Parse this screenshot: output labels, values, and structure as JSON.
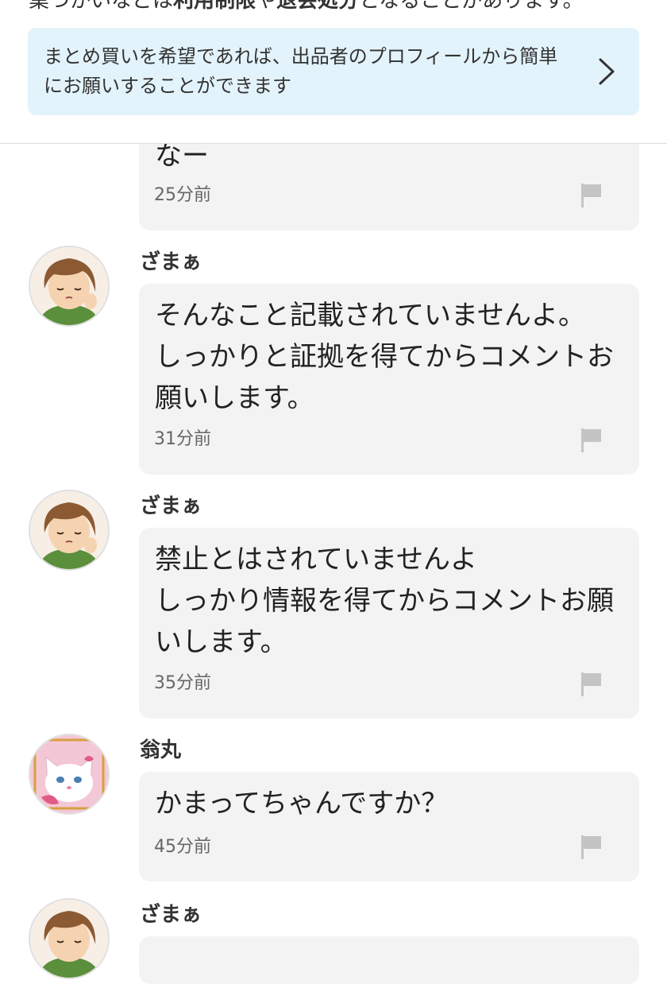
{
  "notice": {
    "line_part1": "業づかいなどは",
    "line_bold1": "利用制限",
    "line_part2": "や",
    "line_bold2": "退会処分",
    "line_part3": "となることがあります。"
  },
  "bundle_banner": {
    "text": "まとめ買いを希望であれば、出品者のプロフィールから簡単にお願いすることができます",
    "icon": "chevron-right-icon"
  },
  "comments": [
    {
      "user": "",
      "text": "なー",
      "time": "25分前"
    },
    {
      "user": "ざまぁ",
      "avatar": "sleepy-person-avatar",
      "text": "そんなこと記載されていませんよ。\nしっかりと証拠を得てからコメントお願いします。",
      "time": "31分前"
    },
    {
      "user": "ざまぁ",
      "avatar": "sleepy-person-avatar",
      "text": "禁止とはされていませんよ\nしっかり情報を得てからコメントお願いします。",
      "time": "35分前"
    },
    {
      "user": "翁丸",
      "avatar": "white-cat-avatar",
      "text": "かまってちゃんですか？",
      "time": "45分前"
    },
    {
      "user": "ざまぁ",
      "avatar": "sleepy-person-avatar",
      "text": "",
      "time": ""
    }
  ],
  "colors": {
    "banner_bg": "#e3f3fb",
    "bubble_bg": "#f3f3f3",
    "flag": "#c4c4c4",
    "avatar_bg": "#f7eee6",
    "hair": "#8b5a33",
    "shirt": "#5b8f3c",
    "cat_bg": "#f4c7d6"
  }
}
